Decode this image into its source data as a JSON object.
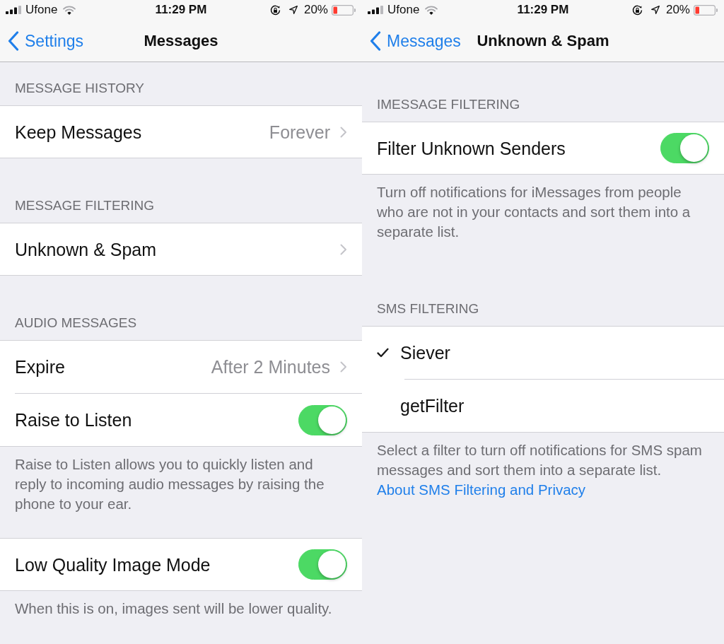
{
  "screens": [
    {
      "status_bar": {
        "carrier": "Ufone",
        "time": "11:29 PM",
        "battery": "20%"
      },
      "nav_bar": {
        "back": "Settings",
        "title": "Messages"
      },
      "sections": [
        {
          "header": "MESSAGE HISTORY",
          "rows": [
            {
              "kind": "disclosure",
              "label": "Keep Messages",
              "value": "Forever"
            }
          ]
        },
        {
          "header": "MESSAGE FILTERING",
          "rows": [
            {
              "kind": "disclosure",
              "label": "Unknown & Spam"
            }
          ]
        },
        {
          "header": "AUDIO MESSAGES",
          "rows": [
            {
              "kind": "disclosure",
              "label": "Expire",
              "value": "After 2 Minutes"
            },
            {
              "kind": "switch",
              "label": "Raise to Listen",
              "on": true
            }
          ],
          "footer": "Raise to Listen allows you to quickly listen and reply to incoming audio messages by raising the phone to your ear."
        },
        {
          "rows": [
            {
              "kind": "switch",
              "label": "Low Quality Image Mode",
              "on": true
            }
          ],
          "footer": "When this is on, images sent will be lower quality."
        }
      ]
    },
    {
      "status_bar": {
        "carrier": "Ufone",
        "time": "11:29 PM",
        "battery": "20%"
      },
      "nav_bar": {
        "back": "Messages",
        "title": "Unknown & Spam"
      },
      "sections": [
        {
          "header": "IMESSAGE FILTERING",
          "rows": [
            {
              "kind": "switch",
              "label": "Filter Unknown Senders",
              "on": true
            }
          ],
          "footer": "Turn off notifications for iMessages from people who are not in your contacts and sort them into a separate list."
        },
        {
          "header": "SMS FILTERING",
          "rows": [
            {
              "kind": "choice",
              "label": "Siever",
              "selected": true
            },
            {
              "kind": "choice",
              "label": "getFilter",
              "selected": false
            }
          ],
          "footer": "Select a filter to turn off notifications for SMS spam messages and sort them into a separate list.",
          "footer_link": "About SMS Filtering and Privacy"
        }
      ]
    }
  ]
}
